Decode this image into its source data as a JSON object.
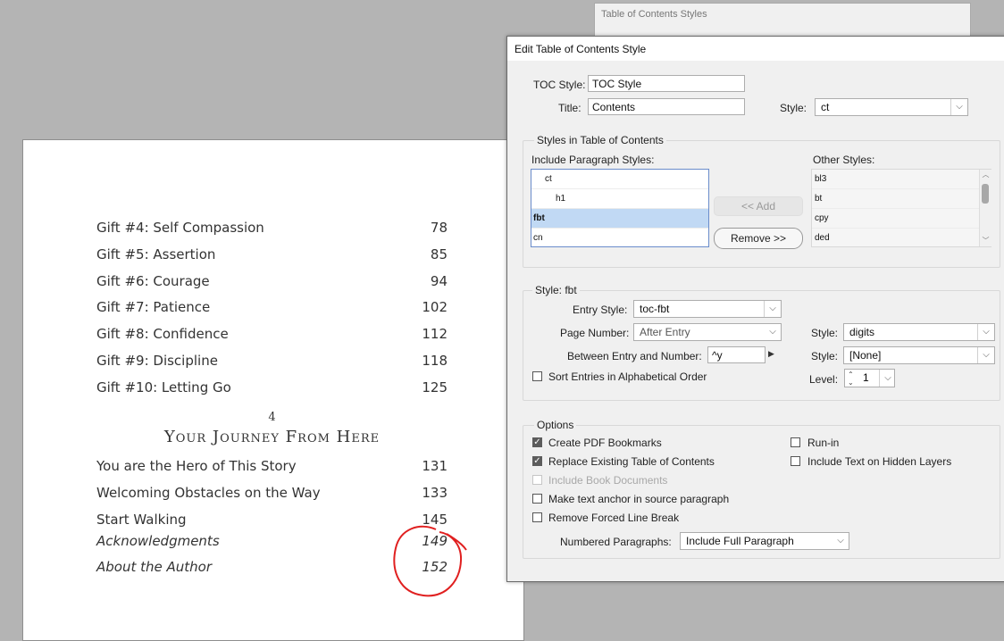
{
  "document": {
    "entries_top": [
      {
        "title": "Gift #4: Self Compassion",
        "page": "78"
      },
      {
        "title": "Gift #5: Assertion",
        "page": "85"
      },
      {
        "title": "Gift #6: Courage",
        "page": "94"
      },
      {
        "title": "Gift #7: Patience",
        "page": "102"
      },
      {
        "title": "Gift #8: Confidence",
        "page": "112"
      },
      {
        "title": "Gift #9: Discipline",
        "page": "118"
      },
      {
        "title": "Gift #10: Letting Go",
        "page": "125"
      }
    ],
    "chapter_number": "4",
    "chapter_title": "Your Journey From Here",
    "entries_bottom": [
      {
        "title": "You are the Hero of This Story",
        "page": "131"
      },
      {
        "title": "Welcoming Obstacles on the Way",
        "page": "133"
      },
      {
        "title": "Start Walking",
        "page": "145"
      },
      {
        "title": "Acknowledgments",
        "page": "149"
      },
      {
        "title": "About the Author",
        "page": "152"
      }
    ],
    "annotation_color": "#e02020"
  },
  "background_window": {
    "title": "Table of Contents Styles"
  },
  "dialog": {
    "title": "Edit Table of Contents Style",
    "toc_style_label": "TOC Style:",
    "toc_style_value": "TOC Style",
    "title_label": "Title:",
    "title_value": "Contents",
    "style_label": "Style:",
    "title_style_value": "ct",
    "styles_group_label": "Styles in Table of Contents",
    "include_label": "Include Paragraph Styles:",
    "include_styles": [
      "ct",
      "h1",
      "fbt",
      "cn"
    ],
    "selected_include": "fbt",
    "other_label": "Other Styles:",
    "other_styles": [
      "bl3",
      "bt",
      "cpy",
      "ded"
    ],
    "add_button": "<< Add",
    "remove_button": "Remove >>",
    "style_group_label": "Style: fbt",
    "entry_style_label": "Entry Style:",
    "entry_style_value": "toc-fbt",
    "page_number_label": "Page Number:",
    "page_number_value": "After Entry",
    "page_number_style_label": "Style:",
    "page_number_style_value": "digits",
    "between_label": "Between Entry and Number:",
    "between_value": "^y",
    "between_style_label": "Style:",
    "between_style_value": "[None]",
    "sort_label": "Sort Entries in Alphabetical Order",
    "sort_checked": false,
    "level_label": "Level:",
    "level_value": "1",
    "options_label": "Options",
    "create_pdf_bookmarks": "Create PDF Bookmarks",
    "create_pdf_bookmarks_checked": true,
    "replace_existing": "Replace Existing Table of Contents",
    "replace_existing_checked": true,
    "include_book_docs": "Include Book Documents",
    "include_book_docs_checked": false,
    "make_anchor": "Make text anchor in source paragraph",
    "make_anchor_checked": false,
    "remove_forced": "Remove Forced Line Break",
    "remove_forced_checked": false,
    "run_in": "Run-in",
    "run_in_checked": false,
    "include_hidden": "Include Text on Hidden Layers",
    "include_hidden_checked": false,
    "numbered_label": "Numbered Paragraphs:",
    "numbered_value": "Include Full Paragraph"
  },
  "icons": {
    "dropdown": "chevron-down-icon",
    "spinner": "spinner-arrows-icon",
    "flyout": "triangle-right-icon",
    "check": "checkmark-icon"
  }
}
